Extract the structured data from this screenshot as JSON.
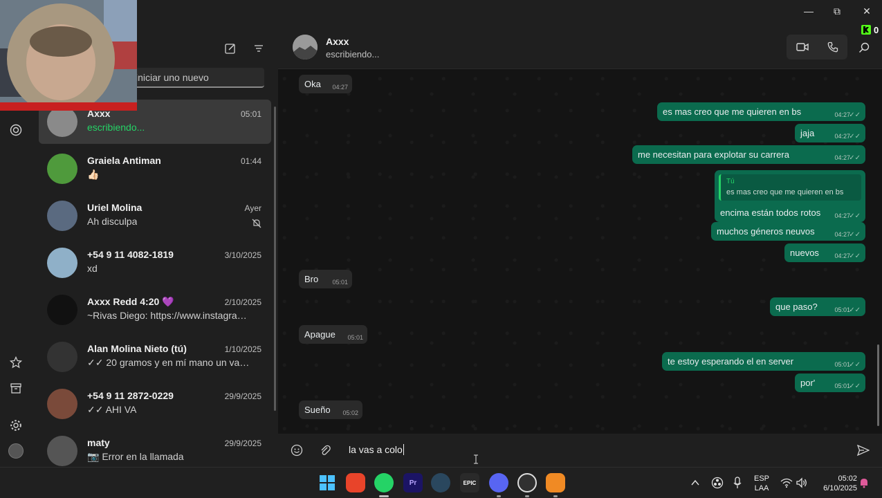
{
  "window": {
    "minimize": "—",
    "maximize": "⧉",
    "close": "✕"
  },
  "overlay_counter": {
    "value": "0"
  },
  "chat_list": {
    "search_placeholder": "iniciar uno nuevo",
    "chats": [
      {
        "name": "Axxx",
        "time": "05:01",
        "preview": "escribiendo...",
        "typing": true,
        "active": true,
        "avatar_color": "#8a8a8a"
      },
      {
        "name": "Graiela Antiman",
        "time": "01:44",
        "preview": "👍🏻",
        "avatar_color": "#4f9a3c"
      },
      {
        "name": "Uriel Molina",
        "time": "Ayer",
        "preview": "Ah disculpa",
        "muted": true,
        "avatar_color": "#5a6a80"
      },
      {
        "name": "+54 9 11 4082-1819",
        "time": "3/10/2025",
        "preview": "xd",
        "avatar_color": "#8fb0c8"
      },
      {
        "name": "Axxx Redd 4:20 💜",
        "time": "2/10/2025",
        "preview": "~Rivas Diego: https://www.instagram.c...",
        "avatar_color": "#111111"
      },
      {
        "name": "Alan Molina Nieto (tú)",
        "time": "1/10/2025",
        "preview": "✓✓ 20 gramos y en mí mano un vaso qu...",
        "avatar_color": "#333333"
      },
      {
        "name": "+54 9 11 2872-0229",
        "time": "29/9/2025",
        "preview": "✓✓ AHI VA",
        "avatar_color": "#7a4a3a"
      },
      {
        "name": "maty",
        "time": "29/9/2025",
        "preview": "📷 Error en la llamada",
        "avatar_color": "#555555"
      }
    ]
  },
  "conversation": {
    "contact_name": "Axxx",
    "status": "escribiendo...",
    "messages": [
      {
        "dir": "in",
        "text": "Oka",
        "time": "04:27"
      },
      {
        "dir": "out",
        "text": "es mas creo que me quieren en bs",
        "time": "04:27"
      },
      {
        "dir": "out",
        "text": "jaja",
        "time": "04:27"
      },
      {
        "dir": "out",
        "text": "me necesitan para explotar su carrera",
        "time": "04:27"
      },
      {
        "dir": "out",
        "text": "encima están todos rotos",
        "time": "04:27",
        "quote_author": "Tú",
        "quote_text": "es mas creo que me quieren en bs"
      },
      {
        "dir": "out",
        "text": "muchos géneros neuvos",
        "time": "04:27"
      },
      {
        "dir": "out",
        "text": "nuevos",
        "time": "04:27"
      },
      {
        "dir": "in",
        "text": "Bro",
        "time": "05:01"
      },
      {
        "dir": "out",
        "text": "que paso?",
        "time": "05:01"
      },
      {
        "dir": "in",
        "text": "Apague",
        "time": "05:01"
      },
      {
        "dir": "out",
        "text": "te estoy esperando el en server",
        "time": "05:01"
      },
      {
        "dir": "out",
        "text": "por'",
        "time": "05:01"
      },
      {
        "dir": "in",
        "text": "Sueño",
        "time": "05:02"
      }
    ],
    "composer_text": "la vas a colo"
  },
  "taskbar": {
    "apps": [
      {
        "name": "windows-start",
        "label": ""
      },
      {
        "name": "brave",
        "label": ""
      },
      {
        "name": "whatsapp",
        "label": ""
      },
      {
        "name": "premiere",
        "label": "Pr"
      },
      {
        "name": "steam",
        "label": ""
      },
      {
        "name": "epic-games",
        "label": "EPIC"
      },
      {
        "name": "discord",
        "label": ""
      },
      {
        "name": "obs",
        "label": ""
      },
      {
        "name": "fl-studio",
        "label": ""
      }
    ],
    "language_line1": "ESP",
    "language_line2": "LAA",
    "clock_time": "05:02",
    "clock_date": "6/10/2025"
  },
  "colors": {
    "accent": "#25d366",
    "outgoing_bubble": "#0b6b4e",
    "incoming_bubble": "#2a2a2a"
  }
}
